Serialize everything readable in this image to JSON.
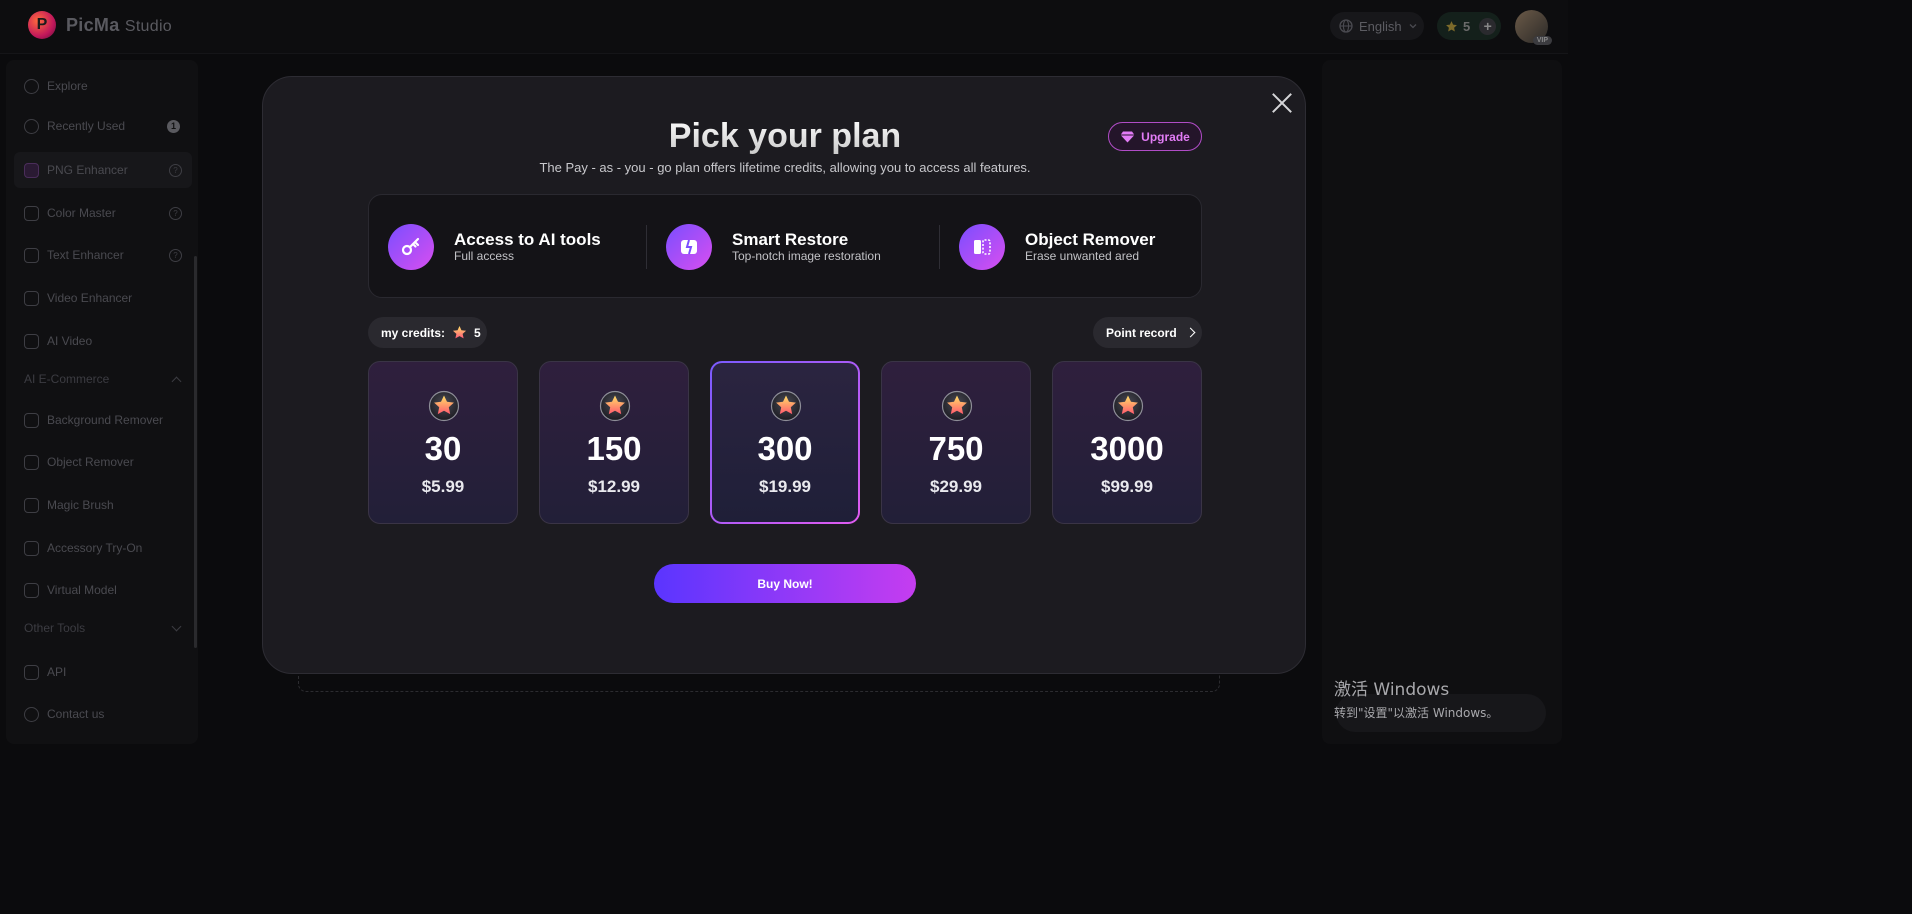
{
  "app": {
    "logo_letter": "P",
    "brand_name": "PicMa",
    "brand_suffix": "Studio"
  },
  "header": {
    "language": "English",
    "credits": "5",
    "add_label": "+",
    "avatar_badge": "VIP"
  },
  "sidebar": {
    "items": [
      {
        "label": "Explore",
        "icon": "explore-icon"
      },
      {
        "label": "Recently Used",
        "icon": "history-icon",
        "badge": "1"
      },
      {
        "label": "PNG Enhancer",
        "icon": "png-icon",
        "help": "?"
      },
      {
        "label": "Color Master",
        "icon": "palette-icon",
        "help": "?"
      },
      {
        "label": "Text Enhancer",
        "icon": "text-icon",
        "help": "?"
      },
      {
        "label": "Video Enhancer",
        "icon": "video-icon"
      },
      {
        "label": "AI Video",
        "icon": "ai-video-icon"
      }
    ],
    "section_ecommerce": "AI E-Commerce",
    "ecommerce_items": [
      {
        "label": "Background Remover",
        "icon": "background-remover-icon"
      },
      {
        "label": "Object Remover",
        "icon": "object-remover-icon"
      },
      {
        "label": "Magic Brush",
        "icon": "brush-icon"
      },
      {
        "label": "Accessory Try-On",
        "icon": "accessory-icon"
      },
      {
        "label": "Virtual Model",
        "icon": "model-icon"
      }
    ],
    "section_other": "Other Tools",
    "bottom_items": [
      {
        "label": "API",
        "icon": "api-icon"
      },
      {
        "label": "Contact us",
        "icon": "contact-icon"
      }
    ]
  },
  "modal": {
    "title": "Pick your plan",
    "subtitle": "The Pay - as - you - go plan offers lifetime credits, allowing you to access all features.",
    "upgrade_label": "Upgrade",
    "features": [
      {
        "title": "Access to AI tools",
        "subtitle": "Full access",
        "icon": "key-icon"
      },
      {
        "title": "Smart Restore",
        "subtitle": "Top-notch image restoration",
        "icon": "restore-icon"
      },
      {
        "title": "Object Remover",
        "subtitle": "Erase unwanted ared",
        "icon": "eraser-icon"
      }
    ],
    "my_credits_label": "my credits:",
    "my_credits_value": "5",
    "point_record_label": "Point record",
    "plans": [
      {
        "credits": "30",
        "price": "$5.99",
        "selected": false
      },
      {
        "credits": "150",
        "price": "$12.99",
        "selected": false
      },
      {
        "credits": "300",
        "price": "$19.99",
        "selected": true
      },
      {
        "credits": "750",
        "price": "$29.99",
        "selected": false
      },
      {
        "credits": "3000",
        "price": "$99.99",
        "selected": false
      }
    ],
    "buy_label": "Buy Now!"
  },
  "watermark": {
    "line1": "激活 Windows",
    "line2": "转到\"设置\"以激活 Windows。"
  },
  "colors": {
    "accent_start": "#5a35ff",
    "accent_end": "#c53df0",
    "background": "#0b0b0d",
    "modal": "#1c1b20"
  }
}
